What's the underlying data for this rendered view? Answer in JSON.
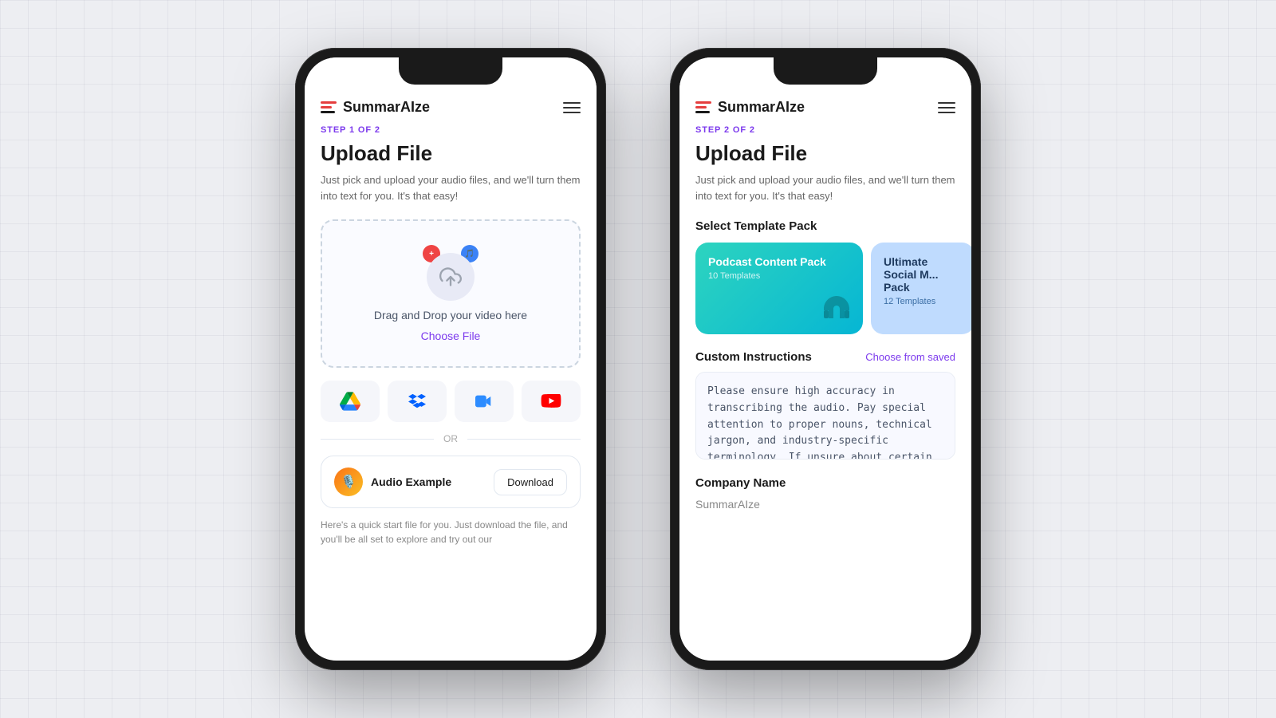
{
  "app": {
    "name": "SummarAIze"
  },
  "phone1": {
    "step": "STEP 1 OF 2",
    "title": "Upload File",
    "subtitle": "Just pick and upload your audio files, and we'll turn them into text for you. It's that easy!",
    "upload_box": {
      "drag_text": "Drag and Drop your video here",
      "choose_text": "Choose File"
    },
    "integrations": [
      {
        "name": "google-drive",
        "label": "Google Drive"
      },
      {
        "name": "dropbox",
        "label": "Dropbox"
      },
      {
        "name": "zoom",
        "label": "Zoom"
      },
      {
        "name": "youtube",
        "label": "YouTube"
      }
    ],
    "or_text": "OR",
    "audio_example": {
      "label": "Audio Example",
      "download_btn": "Download",
      "description": "Here's a quick start file for you. Just download the file, and you'll be all set to explore and try out our"
    }
  },
  "phone2": {
    "step": "STEP 2 OF 2",
    "title": "Upload File",
    "subtitle": "Just pick and upload your audio files, and we'll turn them into text for you. It's that easy!",
    "select_template_label": "Select Template Pack",
    "templates": [
      {
        "name": "Podcast Content Pack",
        "count": "10 Templates",
        "type": "podcast"
      },
      {
        "name": "Ultimate Social M... Pack",
        "count": "12 Templates",
        "type": "social"
      }
    ],
    "custom_instructions": {
      "label": "Custom Instructions",
      "choose_saved": "Choose from saved",
      "text": "Please ensure high accuracy in transcribing the audio. Pay special attention to proper nouns, technical jargon, and industry-specific terminology. If unsure about certain words, flag them for review."
    },
    "company": {
      "label": "Company Name",
      "value": "SummarAIze"
    }
  }
}
